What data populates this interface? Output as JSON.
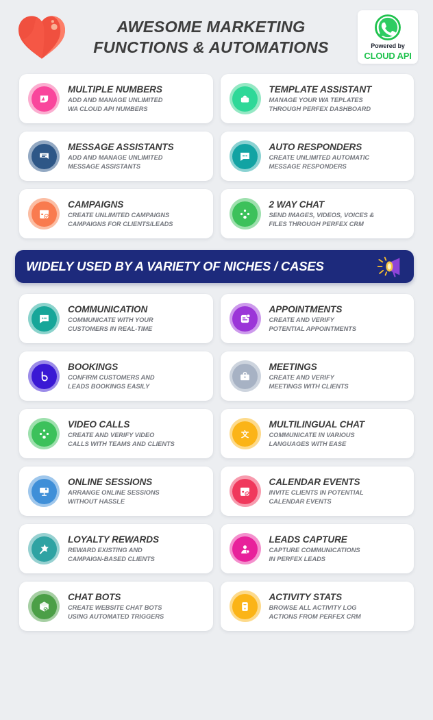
{
  "header": {
    "logo_icon": "heart-icon",
    "title_line1": "AWESOME MARKETING",
    "title_line2": "FUNCTIONS & AUTOMATIONS",
    "badge": {
      "icon": "whatsapp-icon",
      "powered_by": "Powered by",
      "brand": "CLOUD API",
      "brand_color": "#1fc24d"
    }
  },
  "banner": {
    "text": "WIDELY USED BY A VARIETY OF NICHES / CASES",
    "icon": "megaphone-icon",
    "background_color": "#1d2a7c",
    "text_color": "#ffffff"
  },
  "section1_cards": [
    {
      "title": "MULTIPLE NUMBERS",
      "desc_line1": "ADD AND MANAGE UNLIMITED",
      "desc_line2": "WA CLOUD API NUMBERS",
      "icon": "leaf-badge-icon",
      "color": "#f9469c",
      "ring_color": "#fbaed0"
    },
    {
      "title": "TEMPLATE ASSISTANT",
      "desc_line1": "MANAGE YOUR WA TEPLATES",
      "desc_line2": "THROUGH PERFEX DASHBOARD",
      "icon": "template-icon",
      "color": "#2ed898",
      "ring_color": "#95e8c4"
    },
    {
      "title": "MESSAGE ASSISTANTS",
      "desc_line1": "ADD AND MANAGE UNLIMITED",
      "desc_line2": "MESSAGE ASSISTANTS",
      "icon": "message-card-icon",
      "color": "#2e5787",
      "ring_color": "#93a9c3"
    },
    {
      "title": "AUTO RESPONDERS",
      "desc_line1": "CREATE UNLIMITED AUTOMATIC",
      "desc_line2": "MESSAGE RESPONDERS",
      "icon": "chat-dots-icon",
      "color": "#12a3a3",
      "ring_color": "#8ad2d2"
    },
    {
      "title": "CAMPAIGNS",
      "desc_line1": "CREATE UNLIMITED CAMPAIGNS",
      "desc_line2": "CAMPAIGNS FOR CLIENTS/LEADS",
      "icon": "campaign-calendar-icon",
      "color": "#f97b4f",
      "ring_color": "#fbbda3"
    },
    {
      "title": "2 WAY CHAT",
      "desc_line1": "SEND IMAGES, VIDEOS, VOICES &",
      "desc_line2": "FILES THROUGH PERFEX CRM",
      "icon": "share-nodes-icon",
      "color": "#3cc15b",
      "ring_color": "#9de0ad"
    }
  ],
  "section2_cards": [
    {
      "title": "COMMUNICATION",
      "desc_line1": "COMMUNICATE WITH YOUR",
      "desc_line2": "CUSTOMERS IN REAL-TIME",
      "icon": "chat-bubble-icon",
      "color": "#16a699",
      "ring_color": "#8bd3cc"
    },
    {
      "title": "APPOINTMENTS",
      "desc_line1": "CREATE AND VERIFY",
      "desc_line2": "POTENTIAL APPOINTMENTS",
      "icon": "appointment-note-icon",
      "color": "#9b35d8",
      "ring_color": "#cd9aec"
    },
    {
      "title": "BOOKINGS",
      "desc_line1": "CONFIRM CUSTOMERS AND",
      "desc_line2": "LEADS BOOKINGS EASILY",
      "icon": "booking-b-icon",
      "color": "#3a19d4",
      "ring_color": "#9c8ce9"
    },
    {
      "title": "MEETINGS",
      "desc_line1": "CREATE AND VERIFY",
      "desc_line2": "MEETINGS WITH CLIENTS",
      "icon": "briefcase-icon",
      "color": "#a7b2c4",
      "ring_color": "#cdd4de"
    },
    {
      "title": "VIDEO CALLS",
      "desc_line1": "CREATE AND VERIFY VIDEO",
      "desc_line2": "CALLS WITH TEAMS AND CLIENTS",
      "icon": "share-nodes-icon",
      "color": "#3cc15b",
      "ring_color": "#9de0ad"
    },
    {
      "title": "MULTILINGUAL CHAT",
      "desc_line1": "COMMUNICATE IN VARIOUS",
      "desc_line2": "LANGUAGES WITH EASE",
      "icon": "translate-icon",
      "color": "#fbb417",
      "ring_color": "#fdda8b"
    },
    {
      "title": "ONLINE SESSIONS",
      "desc_line1": "ARRANGE ONLINE SESSIONS",
      "desc_line2": "WITHOUT HASSLE",
      "icon": "presentation-icon",
      "color": "#3f8fd8",
      "ring_color": "#9fc7ec"
    },
    {
      "title": "CALENDAR EVENTS",
      "desc_line1": "INVITE CLIENTS IN POTENTIAL",
      "desc_line2": "CALENDAR EVENTS",
      "icon": "calendar-check-icon",
      "color": "#f0385c",
      "ring_color": "#f79bae"
    },
    {
      "title": "LOYALTY REWARDS",
      "desc_line1": "REWARD EXISTING AND",
      "desc_line2": "CAMPAIGN-BASED CLIENTS",
      "icon": "star-badge-icon",
      "color": "#2fa3a3",
      "ring_color": "#97d1d1"
    },
    {
      "title": "LEADS CAPTURE",
      "desc_line1": "CAPTURE COMMUNICATIONS",
      "desc_line2": "IN PERFEX LEADS",
      "icon": "user-capture-icon",
      "color": "#e8219b",
      "ring_color": "#f490cd"
    },
    {
      "title": "CHAT BOTS",
      "desc_line1": "CREATE  WEBSITE CHAT BOTS",
      "desc_line2": "USING AUTOMATED TRIGGERS",
      "icon": "cube-bot-icon",
      "color": "#4c9f47",
      "ring_color": "#a6cfa3"
    },
    {
      "title": "ACTIVITY STATS",
      "desc_line1": "BROWSE ALL ACTIVITY LOG",
      "desc_line2": "ACTIONS FROM PERFEX CRM",
      "icon": "activity-log-icon",
      "color": "#fbb417",
      "ring_color": "#fdda8b"
    }
  ]
}
